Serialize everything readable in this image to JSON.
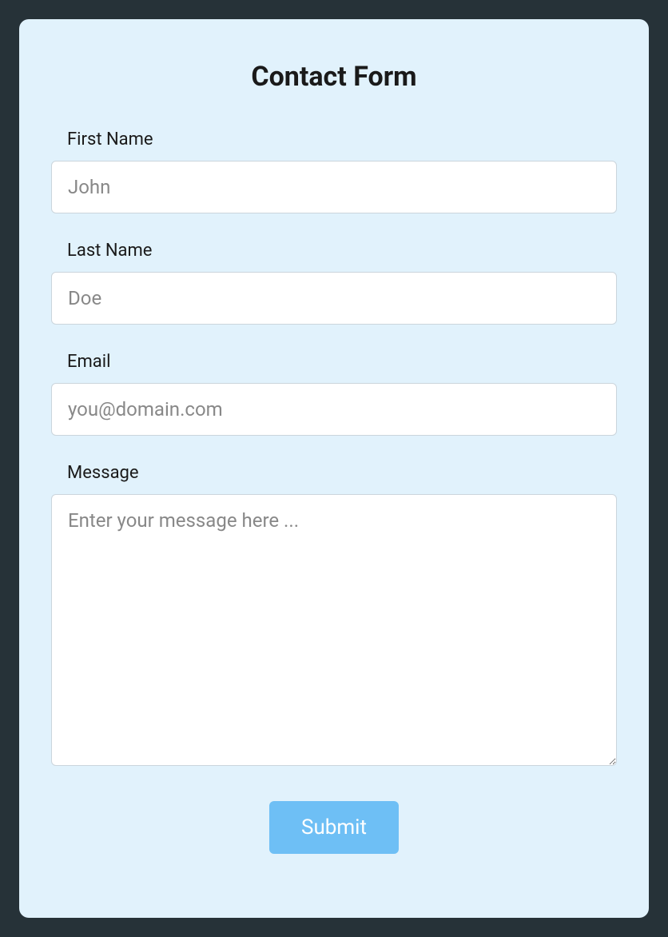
{
  "form": {
    "title": "Contact Form",
    "fields": {
      "first_name": {
        "label": "First Name",
        "placeholder": "John",
        "value": ""
      },
      "last_name": {
        "label": "Last Name",
        "placeholder": "Doe",
        "value": ""
      },
      "email": {
        "label": "Email",
        "placeholder": "you@domain.com",
        "value": ""
      },
      "message": {
        "label": "Message",
        "placeholder": "Enter your message here ...",
        "value": ""
      }
    },
    "submit_label": "Submit"
  }
}
